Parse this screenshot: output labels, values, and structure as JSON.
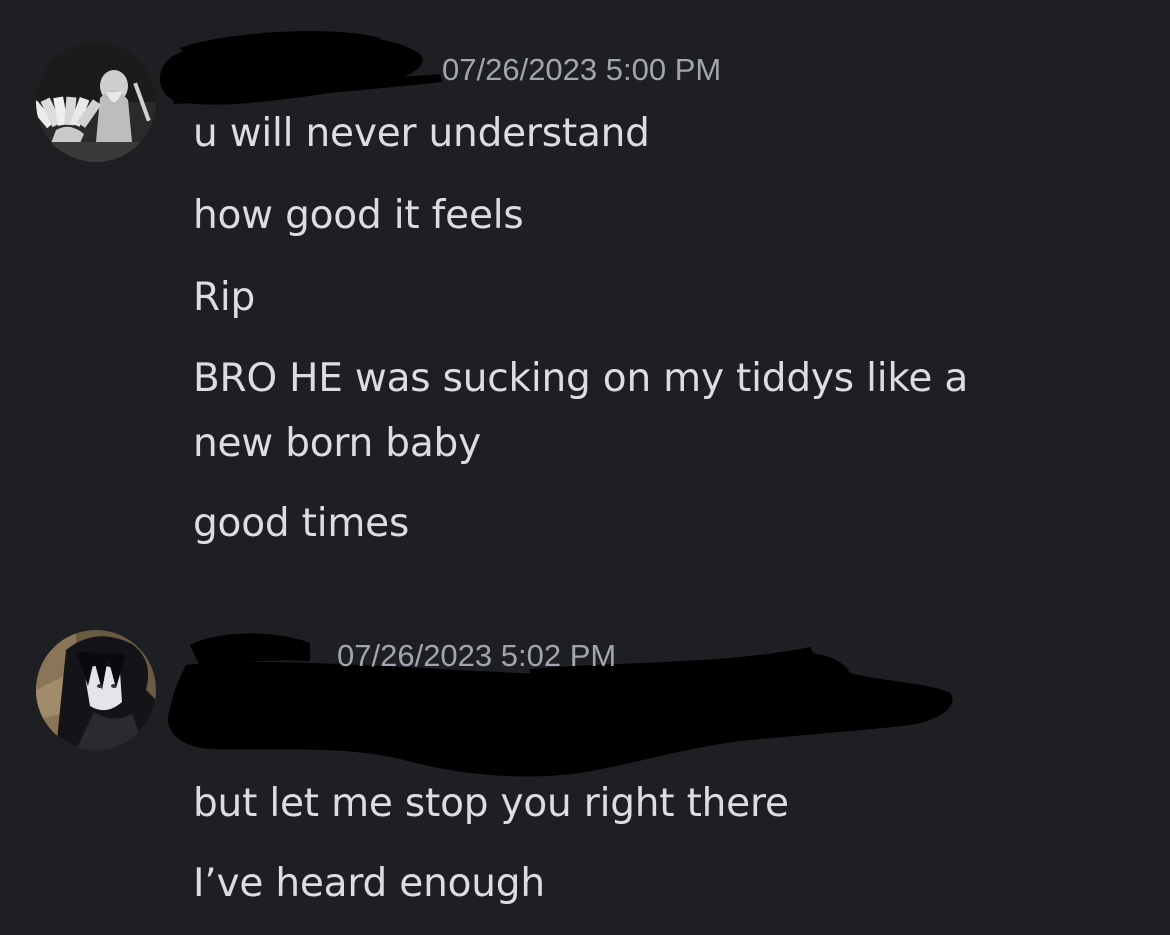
{
  "messages": [
    {
      "timestamp": "07/26/2023 5:00 PM",
      "author_redacted": true,
      "avatar": "avatar-card-fan",
      "lines": [
        "u will never understand",
        "how good it feels",
        "Rip",
        "BRO HE was sucking on my tiddys like a",
        "new born baby",
        "good times"
      ]
    },
    {
      "timestamp": "07/26/2023 5:02 PM",
      "author_redacted": true,
      "avatar": "avatar-dark-haired-character",
      "lines": [
        "but let me stop you right there",
        "I’ve heard enough"
      ]
    }
  ],
  "colors": {
    "background": "#1e1f23",
    "message_text": "#dcdde0",
    "timestamp_text": "#a2a5ad",
    "redaction": "#000000"
  }
}
